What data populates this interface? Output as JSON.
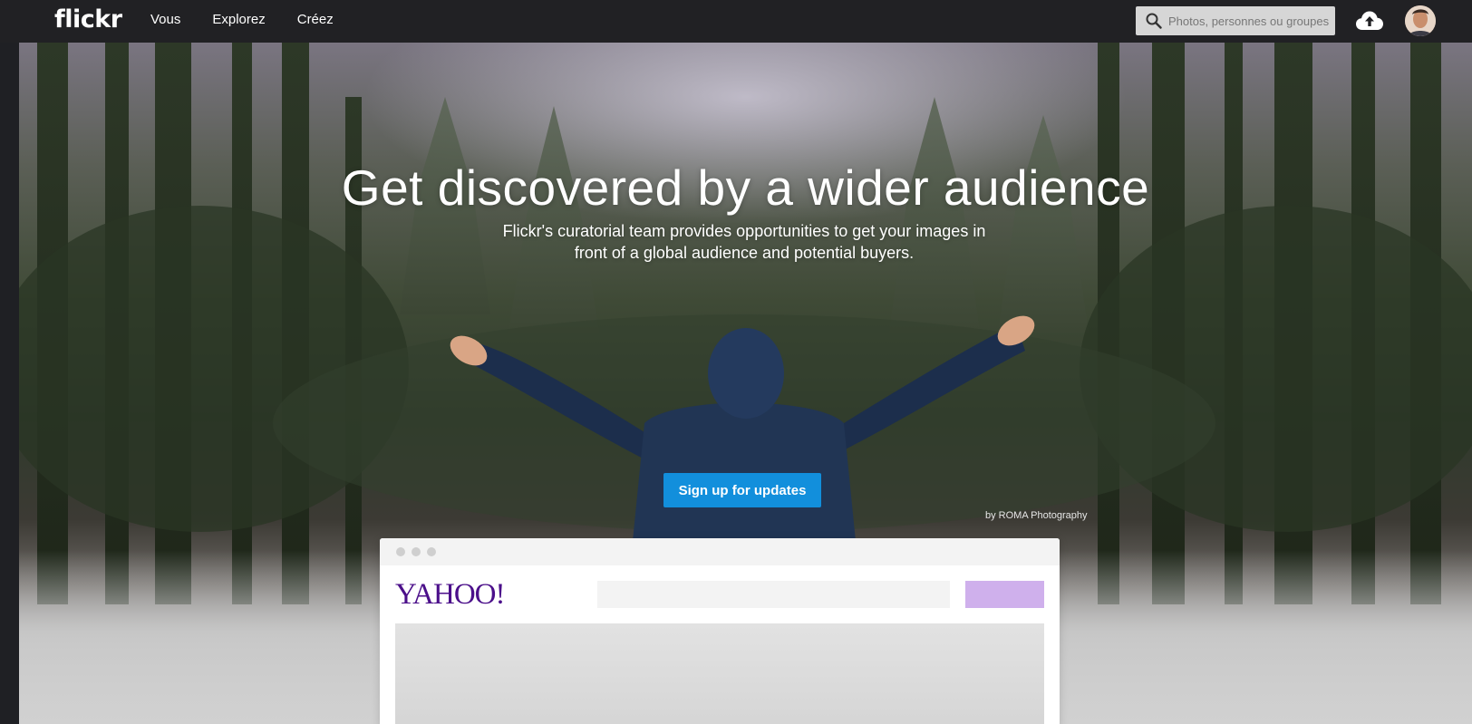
{
  "nav": {
    "logo": "flickr",
    "links": [
      "Vous",
      "Explorez",
      "Créez"
    ],
    "search_placeholder": "Photos, personnes ou groupes",
    "upload_icon": "cloud-upload-icon",
    "avatar_icon": "user-avatar"
  },
  "hero": {
    "headline": "Get discovered by a wider audience",
    "subline": "Flickr's curatorial team provides opportunities to get your images in front of a global audience and potential buyers.",
    "cta_label": "Sign up for updates",
    "credit": "by ROMA Photography"
  },
  "mockup": {
    "logo": "YAHOO!"
  },
  "colors": {
    "nav_bg": "#212124",
    "cta": "#128fdc",
    "yahoo_purple": "#4b0f8a",
    "mock_button": "#cfb0ec"
  }
}
